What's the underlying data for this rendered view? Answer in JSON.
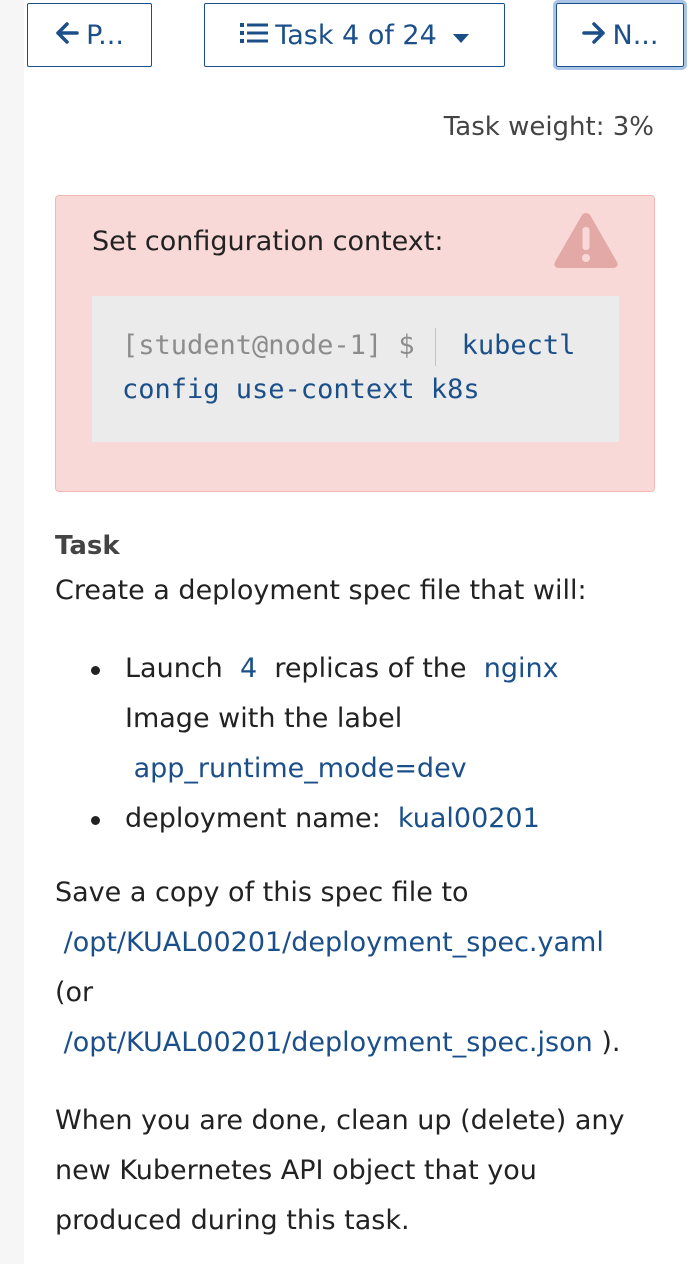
{
  "nav": {
    "prev_label": "P...",
    "task_label": "Task 4 of 24",
    "next_label": "N..."
  },
  "task_weight": "Task weight: 3%",
  "context_alert": {
    "label": "Set configuration context:",
    "prompt": "[student@node-1] $",
    "command_line1": "kubectl",
    "command_line2": "config use-context k8s"
  },
  "task": {
    "heading": "Task",
    "intro": "Create a deployment spec file that will:",
    "bullet1": {
      "text_a": "Launch",
      "replicas": "4",
      "text_b": "replicas of the",
      "image": "nginx",
      "text_c": "Image with the label",
      "label": "app_runtime_mode=dev"
    },
    "bullet2": {
      "text": "deployment name:",
      "name": "kual00201"
    },
    "save_text": "Save a copy of this spec file to",
    "yaml_path": "/opt/KUAL00201/deployment_spec.yaml",
    "or_text": "(or",
    "json_path": "/opt/KUAL00201/deployment_spec.json",
    "close_paren": ").",
    "cleanup_line1": "When you are done, clean up (delete) any",
    "cleanup_line2": "new Kubernetes API object that you",
    "cleanup_line3": "produced during this task."
  },
  "colors": {
    "accent": "#1b4f8a",
    "alert_bg": "#f9d9d7",
    "code_bg": "#ebebeb"
  }
}
